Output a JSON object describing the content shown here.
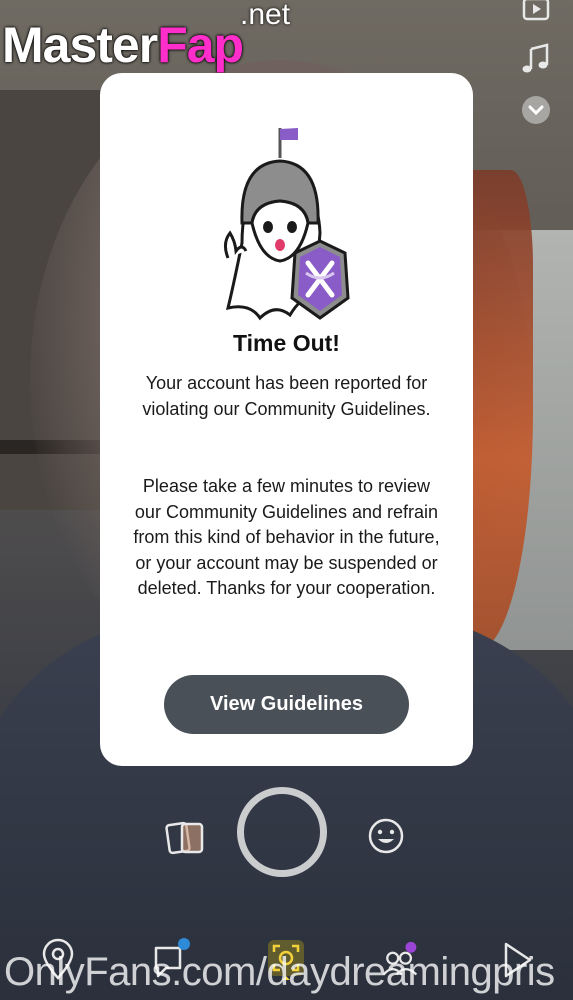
{
  "watermarks": {
    "site_master": "Master",
    "site_fap": "Fap",
    "site_net": ".net",
    "bottom": "OnlyFans.com/daydreamingpris"
  },
  "side_rail": {
    "icons": [
      "video-icon",
      "music-note-icon",
      "chevron-down-icon"
    ]
  },
  "dialog": {
    "title": "Time Out!",
    "paragraph1": "Your account has been reported for violating our Community Guidelines.",
    "paragraph2": "Please take a few minutes to review our Community Guidelines and refrain from this kind of behavior in the future, or your account may be suspended or deleted. Thanks for your cooperation.",
    "button_label": "View Guidelines",
    "accent_color": "#8a5cc7"
  },
  "camera": {
    "icons": [
      "memories-icon",
      "shutter-button",
      "lens-smiley-icon"
    ]
  },
  "nav": {
    "items": [
      "map-icon",
      "chat-icon",
      "camera-scan-icon",
      "stories-icon",
      "spotlight-play-icon"
    ],
    "chat_badge_color": "#2e8ad8",
    "stories_badge_color": "#9b45d6"
  }
}
